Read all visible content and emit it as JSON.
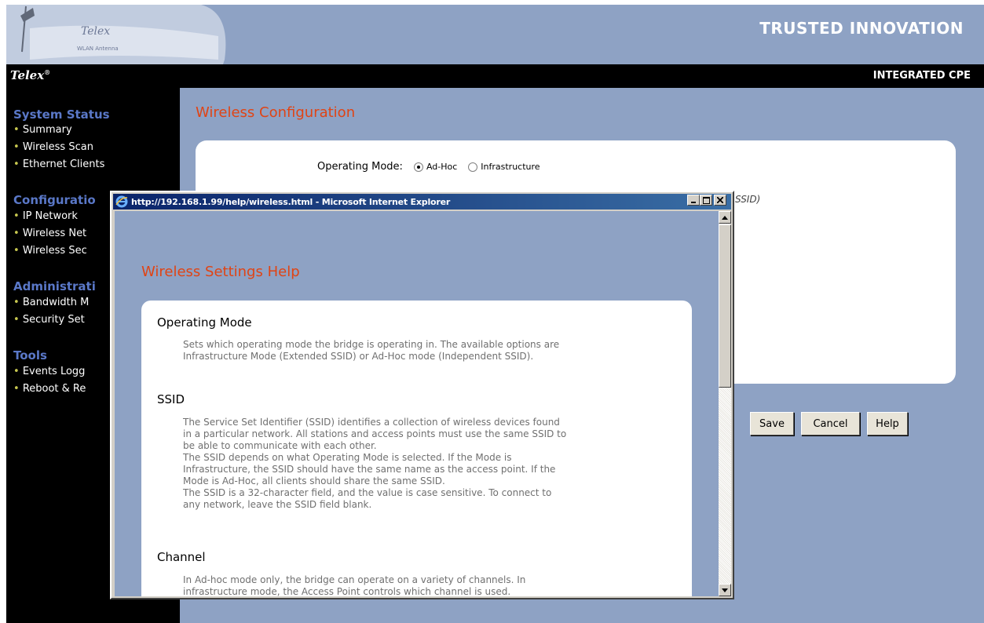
{
  "header": {
    "slogan": "TRUSTED INNOVATION",
    "brand": "Telex",
    "brand_mark": "®",
    "product": "INTEGRATED CPE",
    "antenna_logo_text": "Telex",
    "antenna_sub_text": "WLAN Antenna"
  },
  "sidebar": {
    "sections": [
      {
        "title": "System Status",
        "items": [
          "Summary",
          "Wireless Scan",
          "Ethernet Clients"
        ]
      },
      {
        "title": "Configuratio",
        "items": [
          "IP Network",
          "Wireless Net",
          "Wireless Sec"
        ]
      },
      {
        "title": "Administrati",
        "items": [
          "Bandwidth M",
          "Security Set"
        ]
      },
      {
        "title": "Tools",
        "items": [
          "Events Logg",
          "Reboot & Re"
        ]
      }
    ]
  },
  "main": {
    "title": "Wireless Configuration",
    "operating_mode_label": "Operating Mode:",
    "mode_options": [
      "Ad-Hoc",
      "Infrastructure"
    ],
    "selected_mode": "Ad-Hoc",
    "ssid_hint_fragment": "SSID)",
    "buttons": {
      "save": "Save",
      "cancel": "Cancel",
      "help": "Help"
    }
  },
  "popup": {
    "title": "http://192.168.1.99/help/wireless.html - Microsoft Internet Explorer",
    "heading": "Wireless Settings Help",
    "sections": [
      {
        "title": "Operating Mode",
        "lines": [
          "Sets which operating mode the bridge is operating in. The available options are",
          "Infrastructure Mode (Extended SSID) or Ad-Hoc mode (Independent SSID)."
        ]
      },
      {
        "title": "SSID",
        "lines": [
          "The Service Set Identifier (SSID) identifies a collection of wireless devices found",
          "in a particular network. All stations and access points must use the same SSID to",
          "be able to communicate with each other.",
          "The SSID depends on what Operating Mode is selected. If the Mode is",
          "Infrastructure, the SSID should have the same name as the access point. If the",
          "Mode is Ad-Hoc, all clients should share the same SSID.",
          "The SSID is a 32-character field, and the value is case sensitive. To connect to",
          "any network, leave the SSID field blank."
        ]
      },
      {
        "title": "Channel",
        "lines": [
          "In Ad-hoc mode only, the bridge can operate on a variety of channels. In",
          "infrastructure mode, the Access Point controls which channel is used."
        ]
      }
    ]
  },
  "colors": {
    "banner": "#8ea2c4",
    "accent": "#e04414",
    "nav_title": "#5a78c8",
    "titlebar": "#0a246a"
  }
}
